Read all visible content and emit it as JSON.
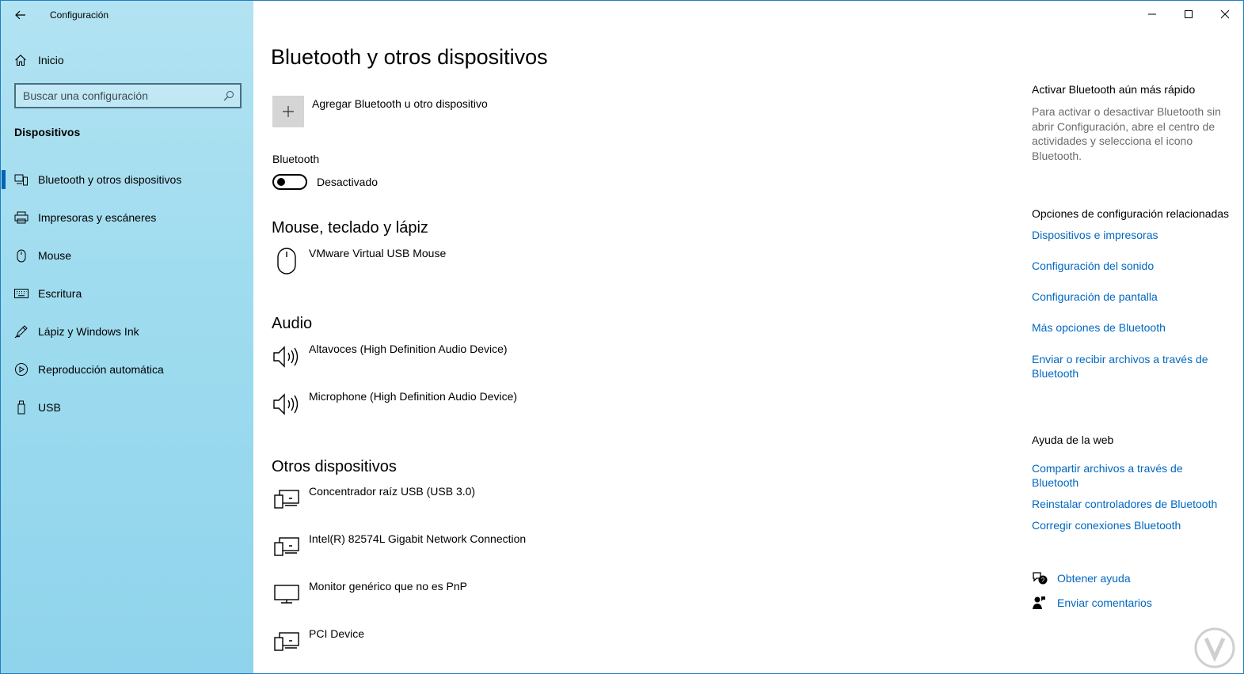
{
  "window": {
    "title": "Configuración"
  },
  "sidebar": {
    "home_label": "Inicio",
    "search_placeholder": "Buscar una configuración",
    "section": "Dispositivos",
    "items": [
      {
        "label": "Bluetooth y otros dispositivos",
        "icon": "bluetooth-devices-icon",
        "active": true
      },
      {
        "label": "Impresoras y escáneres",
        "icon": "printer-icon"
      },
      {
        "label": "Mouse",
        "icon": "mouse-icon"
      },
      {
        "label": "Escritura",
        "icon": "keyboard-icon"
      },
      {
        "label": "Lápiz y Windows Ink",
        "icon": "pen-icon"
      },
      {
        "label": "Reproducción automática",
        "icon": "autoplay-icon"
      },
      {
        "label": "USB",
        "icon": "usb-icon"
      }
    ]
  },
  "main": {
    "title": "Bluetooth y otros dispositivos",
    "add_device_label": "Agregar Bluetooth u otro dispositivo",
    "bluetooth_label": "Bluetooth",
    "bluetooth_state": "Desactivado",
    "groups": {
      "input": {
        "title": "Mouse, teclado y lápiz",
        "devices": [
          "VMware Virtual USB Mouse"
        ]
      },
      "audio": {
        "title": "Audio",
        "devices": [
          "Altavoces (High Definition Audio Device)",
          "Microphone (High Definition Audio Device)"
        ]
      },
      "other": {
        "title": "Otros dispositivos",
        "devices": [
          "Concentrador raíz USB (USB 3.0)",
          "Intel(R) 82574L Gigabit Network Connection",
          "Monitor genérico que no es PnP",
          "PCI Device"
        ]
      }
    }
  },
  "right_panel": {
    "quick": {
      "title": "Activar Bluetooth aún más rápido",
      "text": "Para activar o desactivar Bluetooth sin abrir Configuración, abre el centro de actividades y selecciona el icono Bluetooth."
    },
    "related": {
      "title": "Opciones de configuración relacionadas",
      "links": [
        "Dispositivos e impresoras",
        "Configuración del sonido",
        "Configuración de pantalla",
        "Más opciones de Bluetooth",
        "Enviar o recibir archivos a través de Bluetooth"
      ]
    },
    "web_help": {
      "title": "Ayuda de la web",
      "links": [
        "Compartir archivos a través de Bluetooth",
        "Reinstalar controladores de Bluetooth",
        "Corregir conexiones Bluetooth"
      ]
    },
    "get_help": "Obtener ayuda",
    "feedback": "Enviar comentarios"
  },
  "colors": {
    "accent": "#0063b1",
    "link": "#0067c0",
    "sidebar_bg": "#a0dcef"
  }
}
